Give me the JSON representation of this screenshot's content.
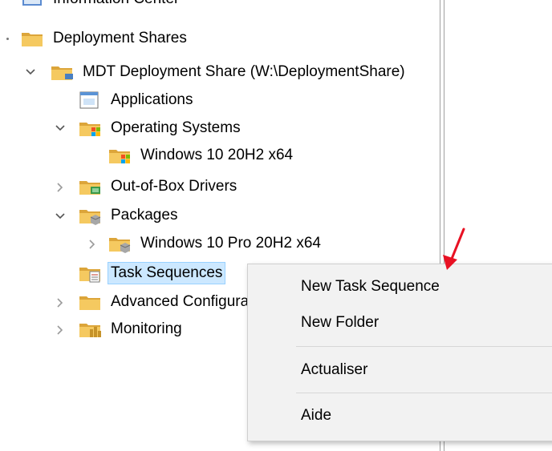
{
  "tree": {
    "top_partial": "Information Center",
    "deployment_shares": "Deployment Shares",
    "mdt_share": "MDT Deployment Share (W:\\DeploymentShare)",
    "applications": "Applications",
    "operating_systems": "Operating Systems",
    "win10_os": "Windows 10 20H2 x64",
    "drivers": "Out-of-Box Drivers",
    "packages": "Packages",
    "win10_pro_pkg": "Windows 10 Pro 20H2 x64",
    "task_sequences": "Task Sequences",
    "advanced_config": "Advanced Configuration",
    "monitoring": "Monitoring"
  },
  "context_menu": {
    "new_task_sequence": "New Task Sequence",
    "new_folder": "New Folder",
    "refresh": "Actualiser",
    "help": "Aide"
  },
  "colors": {
    "selection_bg": "#cce8ff",
    "selection_border": "#99d1ff",
    "menu_bg": "#f2f2f2",
    "arrow": "#e81123",
    "folder": "#e6b64c"
  }
}
